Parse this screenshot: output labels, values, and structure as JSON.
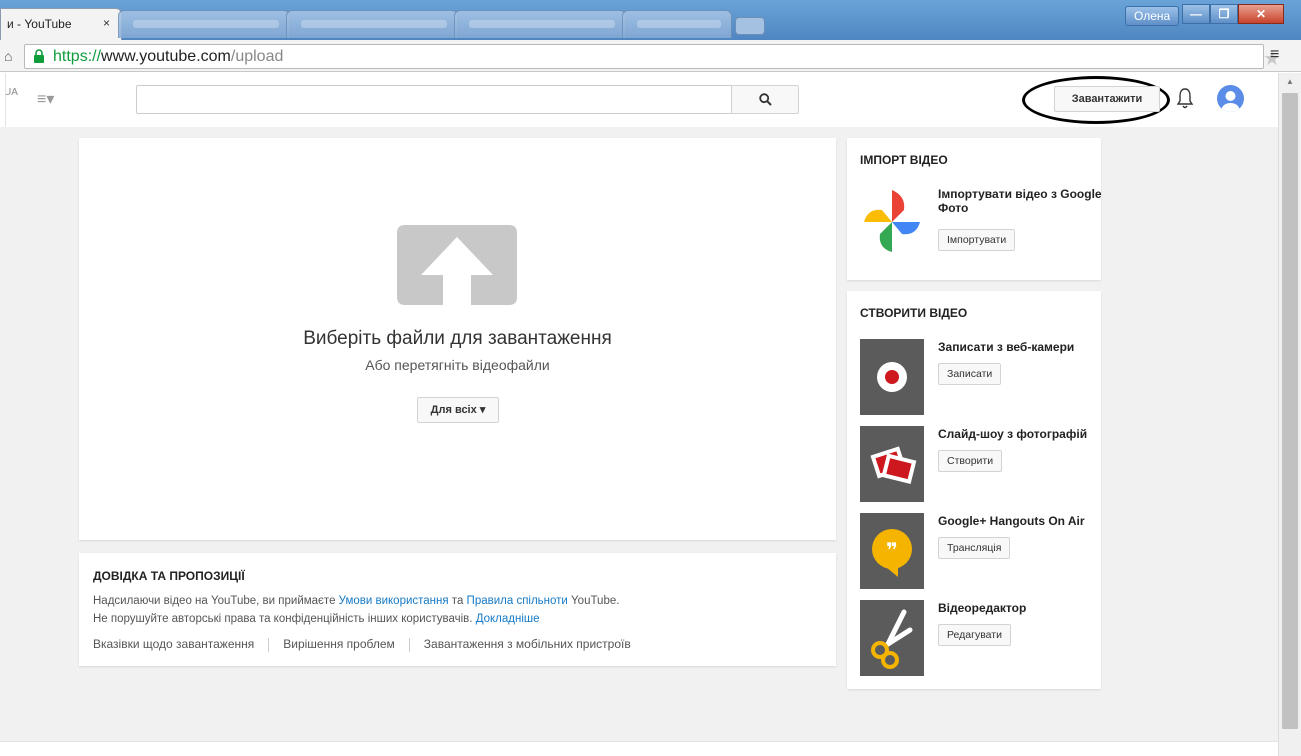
{
  "browser": {
    "active_tab_title": "и - YouTube",
    "tab_close": "×",
    "user_badge": "Олена",
    "url": {
      "scheme": "https://",
      "host": "www.youtube.com",
      "path": "/upload"
    },
    "window_controls": {
      "minimize": "—",
      "maximize": "❐",
      "close": "✕"
    }
  },
  "masthead": {
    "locale": "UA",
    "search_placeholder": "",
    "upload_label": "Завантажити"
  },
  "upload": {
    "title": "Виберіть файли для завантаження",
    "subtitle": "Або перетягніть відеофайли",
    "privacy_label": "Для всіх"
  },
  "help": {
    "title": "ДОВІДКА ТА ПРОПОЗИЦІЇ",
    "line1_prefix": "Надсилаючи відео на YouTube, ви приймаєте ",
    "terms_link": "Умови використання",
    "line1_middle": " та ",
    "guidelines_link": "Правила спільноти",
    "line1_suffix": " YouTube.",
    "line2_prefix": "Не порушуйте авторські права та конфіденційність інших користувачів. ",
    "learn_more_link": "Докладніше",
    "links": [
      "Вказівки щодо завантаження",
      "Вирішення проблем",
      "Завантаження з мобільних пристроїв"
    ]
  },
  "import": {
    "title": "ІМПОРТ ВІДЕО",
    "item_label": "Імпортувати відео з Google Фото",
    "item_button": "Імпортувати"
  },
  "create": {
    "title": "СТВОРИТИ ВІДЕО",
    "items": [
      {
        "label": "Записати з веб-камери",
        "button": "Записати",
        "icon": "webcam-record-icon"
      },
      {
        "label": "Слайд-шоу з фотографій",
        "button": "Створити",
        "icon": "slideshow-icon"
      },
      {
        "label": "Google+ Hangouts On Air",
        "button": "Трансляція",
        "icon": "hangouts-icon"
      },
      {
        "label": "Відеоредактор",
        "button": "Редагувати",
        "icon": "scissors-icon"
      }
    ]
  },
  "colors": {
    "link": "#167ac6",
    "url_scheme": "#0f9d3c",
    "page_background": "#f1f1f1",
    "record_red": "#cc181e",
    "hangouts_yellow": "#f4b400"
  }
}
